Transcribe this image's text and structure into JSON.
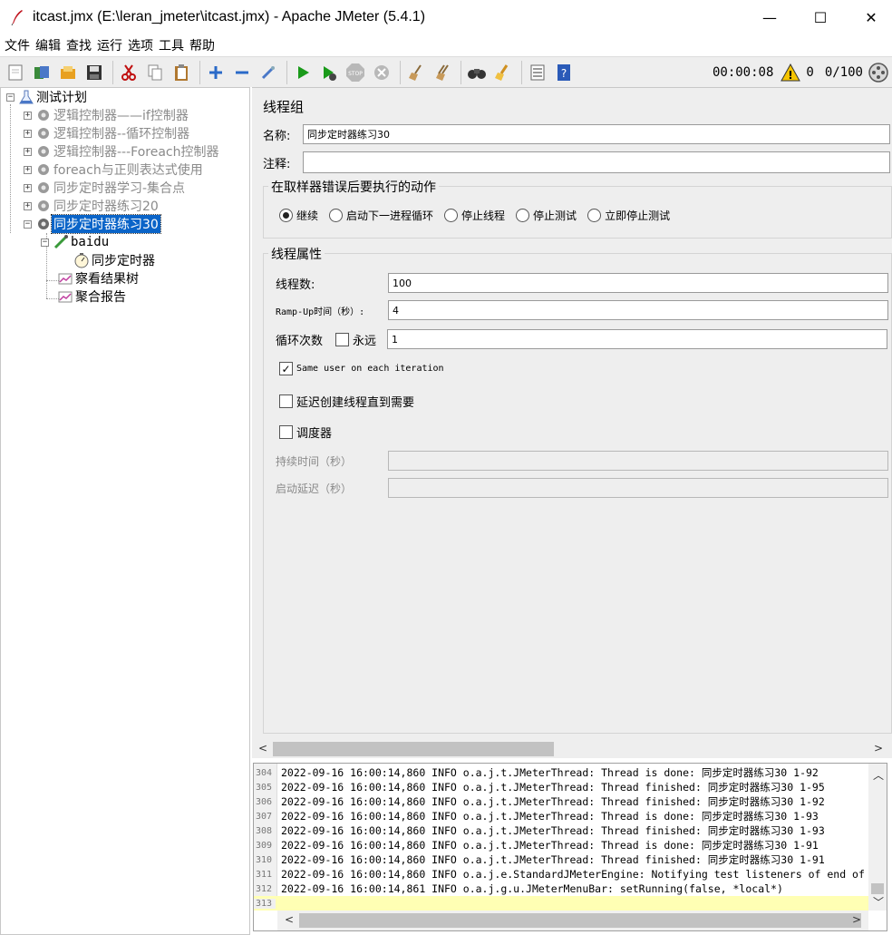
{
  "window": {
    "title": "itcast.jmx (E:\\leran_jmeter\\itcast.jmx) - Apache JMeter (5.4.1)",
    "minimize": "—",
    "maximize": "☐",
    "close": "✕"
  },
  "menu": [
    "文件",
    "编辑",
    "查找",
    "运行",
    "选项",
    "工具",
    "帮助"
  ],
  "toolbar": {
    "timer": "00:00:08",
    "warning_count": "0",
    "threads": "0/100"
  },
  "tree": {
    "root": "测试计划",
    "items": [
      {
        "label": "逻辑控制器——if控制器"
      },
      {
        "label": "逻辑控制器--循环控制器"
      },
      {
        "label": "逻辑控制器---Foreach控制器"
      },
      {
        "label": "foreach与正则表达式使用"
      },
      {
        "label": "同步定时器学习-集合点"
      },
      {
        "label": "同步定时器练习20"
      },
      {
        "label": "同步定时器练习30"
      }
    ],
    "sampler": "baidu",
    "timer": "同步定时器",
    "listener1": "察看结果树",
    "listener2": "聚合报告"
  },
  "form": {
    "title": "线程组",
    "name_label": "名称:",
    "name_value": "同步定时器练习30",
    "comment_label": "注释:",
    "comment_value": "",
    "error_group": "在取样器错误后要执行的动作",
    "error_options": [
      "继续",
      "启动下一进程循环",
      "停止线程",
      "停止测试",
      "立即停止测试"
    ],
    "props_group": "线程属性",
    "threads_label": "线程数:",
    "threads_value": "100",
    "rampup_label": "Ramp-Up时间（秒）:",
    "rampup_value": "4",
    "loop_label": "循环次数",
    "forever_label": "永远",
    "loop_value": "1",
    "same_user_label": "Same user on each iteration",
    "delay_label": "延迟创建线程直到需要",
    "scheduler_label": "调度器",
    "duration_label": "持续时间（秒）",
    "startup_label": "启动延迟（秒）"
  },
  "log": {
    "lines": [
      {
        "n": "304",
        "text": "2022-09-16 16:00:14,860 INFO o.a.j.t.JMeterThread: Thread is done: 同步定时器练习30 1-92"
      },
      {
        "n": "305",
        "text": "2022-09-16 16:00:14,860 INFO o.a.j.t.JMeterThread: Thread finished: 同步定时器练习30 1-95"
      },
      {
        "n": "306",
        "text": "2022-09-16 16:00:14,860 INFO o.a.j.t.JMeterThread: Thread finished: 同步定时器练习30 1-92"
      },
      {
        "n": "307",
        "text": "2022-09-16 16:00:14,860 INFO o.a.j.t.JMeterThread: Thread is done: 同步定时器练习30 1-93"
      },
      {
        "n": "308",
        "text": "2022-09-16 16:00:14,860 INFO o.a.j.t.JMeterThread: Thread finished: 同步定时器练习30 1-93"
      },
      {
        "n": "309",
        "text": "2022-09-16 16:00:14,860 INFO o.a.j.t.JMeterThread: Thread is done: 同步定时器练习30 1-91"
      },
      {
        "n": "310",
        "text": "2022-09-16 16:00:14,860 INFO o.a.j.t.JMeterThread: Thread finished: 同步定时器练习30 1-91"
      },
      {
        "n": "311",
        "text": "2022-09-16 16:00:14,860 INFO o.a.j.e.StandardJMeterEngine: Notifying test listeners of end of"
      },
      {
        "n": "312",
        "text": "2022-09-16 16:00:14,861 INFO o.a.j.g.u.JMeterMenuBar: setRunning(false, *local*)"
      },
      {
        "n": "313",
        "text": ""
      }
    ]
  },
  "colors": {
    "selected": "#0a64c8",
    "run_green": "#1a9a1a",
    "warning": "#f5c400"
  }
}
